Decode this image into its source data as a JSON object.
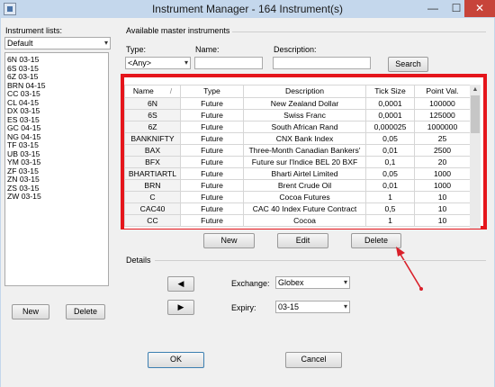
{
  "window": {
    "title": "Instrument Manager - 164 Instrument(s)",
    "min_glyph": "—",
    "max_glyph": "☐",
    "close_glyph": "✕"
  },
  "left": {
    "lists_label": "Instrument lists:",
    "list_select": "Default",
    "items": [
      "6N 03-15",
      "6S 03-15",
      "6Z 03-15",
      "BRN 04-15",
      "CC 03-15",
      "CL 04-15",
      "DX 03-15",
      "ES 03-15",
      "GC 04-15",
      "NG 04-15",
      "TF 03-15",
      "UB 03-15",
      "YM 03-15",
      "ZF 03-15",
      "ZN 03-15",
      "ZS 03-15",
      "ZW 03-15"
    ],
    "new_button": "New",
    "delete_button": "Delete"
  },
  "master": {
    "group_label": "Available master instruments",
    "type_label": "Type:",
    "type_value": "<Any>",
    "name_label": "Name:",
    "name_value": "",
    "desc_label": "Description:",
    "desc_value": "",
    "search_button": "Search"
  },
  "table": {
    "columns": [
      "Name",
      "Type",
      "Description",
      "Tick Size",
      "Point Val."
    ],
    "sort_glyph": "/",
    "scroll_up_glyph": "▲",
    "rows": [
      [
        "6N",
        "Future",
        "New Zealand Dollar",
        "0,0001",
        "100000"
      ],
      [
        "6S",
        "Future",
        "Swiss Franc",
        "0,0001",
        "125000"
      ],
      [
        "6Z",
        "Future",
        "South African Rand",
        "0,000025",
        "1000000"
      ],
      [
        "BANKNIFTY",
        "Future",
        "CNX Bank Index",
        "0,05",
        "25"
      ],
      [
        "BAX",
        "Future",
        "Three-Month Canadian Bankers'",
        "0,01",
        "2500"
      ],
      [
        "BFX",
        "Future",
        "Future sur l'Indice BEL 20 BXF",
        "0,1",
        "20"
      ],
      [
        "BHARTIARTL",
        "Future",
        "Bharti Airtel Limited",
        "0,05",
        "1000"
      ],
      [
        "BRN",
        "Future",
        "Brent Crude Oil",
        "0,01",
        "1000"
      ],
      [
        "C",
        "Future",
        "Cocoa Futures",
        "1",
        "10"
      ],
      [
        "CAC40",
        "Future",
        "CAC 40 Index Future Contract",
        "0,5",
        "10"
      ],
      [
        "CC",
        "Future",
        "Cocoa",
        "1",
        "10"
      ]
    ]
  },
  "actions": {
    "new_button": "New",
    "edit_button": "Edit",
    "delete_button": "Delete"
  },
  "details": {
    "group_label": "Details",
    "prev_glyph": "◀",
    "next_glyph": "▶",
    "exchange_label": "Exchange:",
    "exchange_value": "Globex",
    "expiry_label": "Expiry:",
    "expiry_value": "03-15",
    "dropdown_glyph": "▾"
  },
  "footer": {
    "ok_button": "OK",
    "cancel_button": "Cancel"
  },
  "colors": {
    "highlight_frame": "#e5151b",
    "arrow": "#d9202a"
  }
}
